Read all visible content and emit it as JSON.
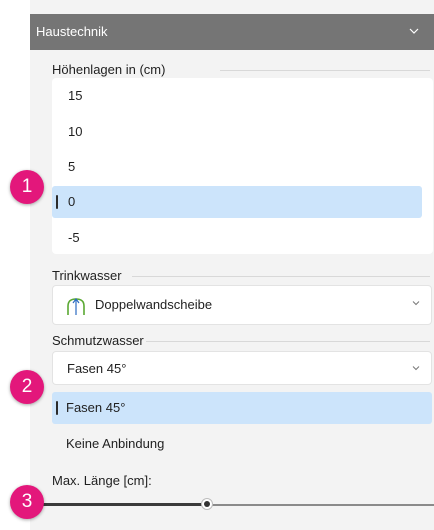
{
  "panel": {
    "title": "Haustechnik"
  },
  "heights": {
    "label": "Höhenlagen in (cm)",
    "items": [
      "15",
      "10",
      "5",
      "0",
      "-5"
    ],
    "selected": "0"
  },
  "trinkwasser": {
    "label": "Trinkwasser",
    "value": "Doppelwandscheibe",
    "icon": "doppelwandscheibe-icon"
  },
  "schmutzwasser": {
    "label": "Schmutzwasser",
    "value": "Fasen 45°",
    "options": [
      "Fasen 45°",
      "Keine Anbindung"
    ],
    "selected": "Fasen 45°"
  },
  "max_length": {
    "label": "Max. Länge [cm]:",
    "value_fraction": 0.43
  },
  "markers": [
    "1",
    "2",
    "3"
  ],
  "colors": {
    "marker": "#e3177b",
    "header": "#757575",
    "selection": "#cce4fb"
  }
}
